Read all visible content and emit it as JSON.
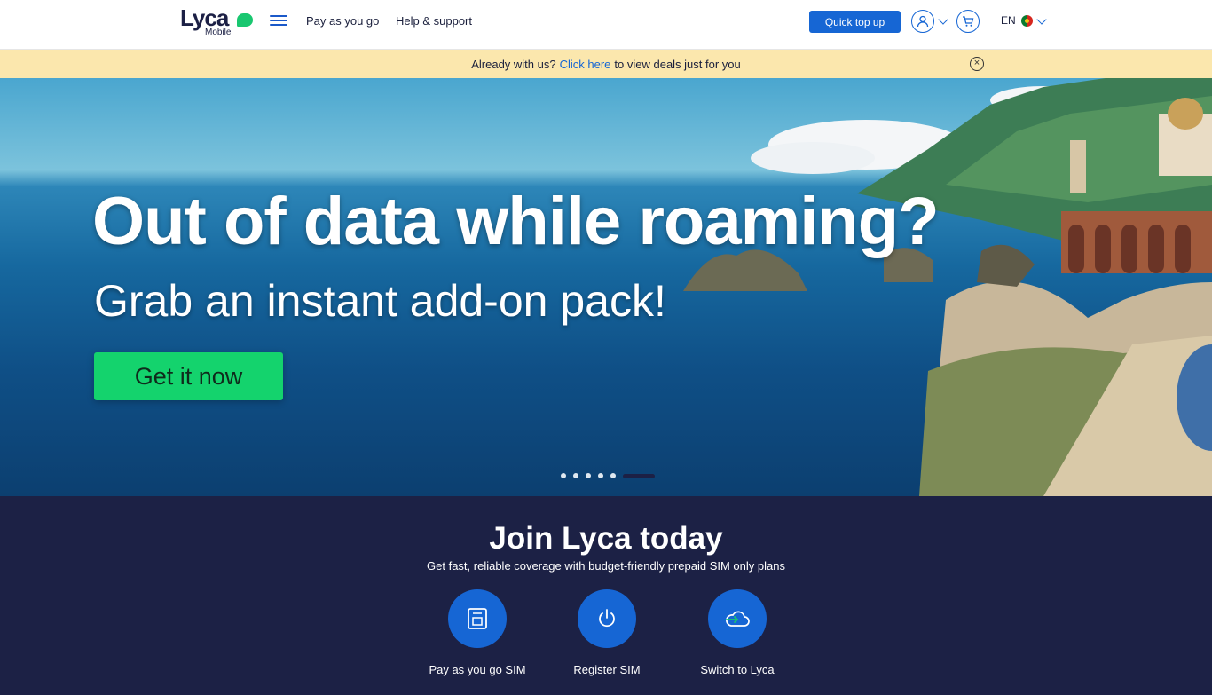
{
  "header": {
    "logo_word": "Lyca",
    "logo_sub": "Mobile",
    "nav": [
      "Pay as you go",
      "Help & support"
    ],
    "quick_top_up": "Quick top up",
    "language": "EN",
    "icons": [
      "menu-icon",
      "user-icon",
      "cart-icon",
      "chevron-down-icon",
      "flag-icon"
    ]
  },
  "banner": {
    "prefix": "Already with us?",
    "link": "Click here",
    "suffix": "to view deals just for you",
    "close": "×"
  },
  "hero": {
    "title": "Out of data while roaming?",
    "subtitle": "Grab an instant add-on pack!",
    "cta": "Get it now",
    "slides": 6,
    "active_slide": 6
  },
  "join": {
    "title": "Join Lyca today",
    "subtitle": "Get fast, reliable coverage with budget-friendly prepaid SIM only plans",
    "options": [
      {
        "label": "Pay as you go SIM",
        "icon": "sim-card-icon"
      },
      {
        "label": "Register SIM",
        "icon": "power-icon"
      },
      {
        "label": "Switch to Lyca",
        "icon": "cloud-switch-icon"
      }
    ]
  },
  "colors": {
    "primary": "#1666d4",
    "brand_green": "#19c770",
    "navy": "#1c2145",
    "banner_bg": "#fbe7ad",
    "cta_green": "#14d36d"
  }
}
